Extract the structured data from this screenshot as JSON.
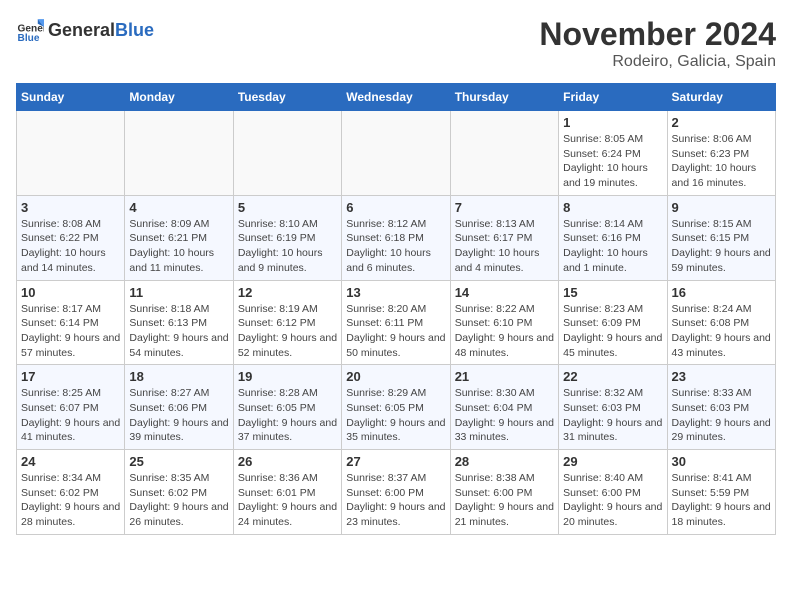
{
  "header": {
    "logo_general": "General",
    "logo_blue": "Blue",
    "month_title": "November 2024",
    "location": "Rodeiro, Galicia, Spain"
  },
  "weekdays": [
    "Sunday",
    "Monday",
    "Tuesday",
    "Wednesday",
    "Thursday",
    "Friday",
    "Saturday"
  ],
  "weeks": [
    [
      {
        "day": "",
        "info": ""
      },
      {
        "day": "",
        "info": ""
      },
      {
        "day": "",
        "info": ""
      },
      {
        "day": "",
        "info": ""
      },
      {
        "day": "",
        "info": ""
      },
      {
        "day": "1",
        "info": "Sunrise: 8:05 AM\nSunset: 6:24 PM\nDaylight: 10 hours and 19 minutes."
      },
      {
        "day": "2",
        "info": "Sunrise: 8:06 AM\nSunset: 6:23 PM\nDaylight: 10 hours and 16 minutes."
      }
    ],
    [
      {
        "day": "3",
        "info": "Sunrise: 8:08 AM\nSunset: 6:22 PM\nDaylight: 10 hours and 14 minutes."
      },
      {
        "day": "4",
        "info": "Sunrise: 8:09 AM\nSunset: 6:21 PM\nDaylight: 10 hours and 11 minutes."
      },
      {
        "day": "5",
        "info": "Sunrise: 8:10 AM\nSunset: 6:19 PM\nDaylight: 10 hours and 9 minutes."
      },
      {
        "day": "6",
        "info": "Sunrise: 8:12 AM\nSunset: 6:18 PM\nDaylight: 10 hours and 6 minutes."
      },
      {
        "day": "7",
        "info": "Sunrise: 8:13 AM\nSunset: 6:17 PM\nDaylight: 10 hours and 4 minutes."
      },
      {
        "day": "8",
        "info": "Sunrise: 8:14 AM\nSunset: 6:16 PM\nDaylight: 10 hours and 1 minute."
      },
      {
        "day": "9",
        "info": "Sunrise: 8:15 AM\nSunset: 6:15 PM\nDaylight: 9 hours and 59 minutes."
      }
    ],
    [
      {
        "day": "10",
        "info": "Sunrise: 8:17 AM\nSunset: 6:14 PM\nDaylight: 9 hours and 57 minutes."
      },
      {
        "day": "11",
        "info": "Sunrise: 8:18 AM\nSunset: 6:13 PM\nDaylight: 9 hours and 54 minutes."
      },
      {
        "day": "12",
        "info": "Sunrise: 8:19 AM\nSunset: 6:12 PM\nDaylight: 9 hours and 52 minutes."
      },
      {
        "day": "13",
        "info": "Sunrise: 8:20 AM\nSunset: 6:11 PM\nDaylight: 9 hours and 50 minutes."
      },
      {
        "day": "14",
        "info": "Sunrise: 8:22 AM\nSunset: 6:10 PM\nDaylight: 9 hours and 48 minutes."
      },
      {
        "day": "15",
        "info": "Sunrise: 8:23 AM\nSunset: 6:09 PM\nDaylight: 9 hours and 45 minutes."
      },
      {
        "day": "16",
        "info": "Sunrise: 8:24 AM\nSunset: 6:08 PM\nDaylight: 9 hours and 43 minutes."
      }
    ],
    [
      {
        "day": "17",
        "info": "Sunrise: 8:25 AM\nSunset: 6:07 PM\nDaylight: 9 hours and 41 minutes."
      },
      {
        "day": "18",
        "info": "Sunrise: 8:27 AM\nSunset: 6:06 PM\nDaylight: 9 hours and 39 minutes."
      },
      {
        "day": "19",
        "info": "Sunrise: 8:28 AM\nSunset: 6:05 PM\nDaylight: 9 hours and 37 minutes."
      },
      {
        "day": "20",
        "info": "Sunrise: 8:29 AM\nSunset: 6:05 PM\nDaylight: 9 hours and 35 minutes."
      },
      {
        "day": "21",
        "info": "Sunrise: 8:30 AM\nSunset: 6:04 PM\nDaylight: 9 hours and 33 minutes."
      },
      {
        "day": "22",
        "info": "Sunrise: 8:32 AM\nSunset: 6:03 PM\nDaylight: 9 hours and 31 minutes."
      },
      {
        "day": "23",
        "info": "Sunrise: 8:33 AM\nSunset: 6:03 PM\nDaylight: 9 hours and 29 minutes."
      }
    ],
    [
      {
        "day": "24",
        "info": "Sunrise: 8:34 AM\nSunset: 6:02 PM\nDaylight: 9 hours and 28 minutes."
      },
      {
        "day": "25",
        "info": "Sunrise: 8:35 AM\nSunset: 6:02 PM\nDaylight: 9 hours and 26 minutes."
      },
      {
        "day": "26",
        "info": "Sunrise: 8:36 AM\nSunset: 6:01 PM\nDaylight: 9 hours and 24 minutes."
      },
      {
        "day": "27",
        "info": "Sunrise: 8:37 AM\nSunset: 6:00 PM\nDaylight: 9 hours and 23 minutes."
      },
      {
        "day": "28",
        "info": "Sunrise: 8:38 AM\nSunset: 6:00 PM\nDaylight: 9 hours and 21 minutes."
      },
      {
        "day": "29",
        "info": "Sunrise: 8:40 AM\nSunset: 6:00 PM\nDaylight: 9 hours and 20 minutes."
      },
      {
        "day": "30",
        "info": "Sunrise: 8:41 AM\nSunset: 5:59 PM\nDaylight: 9 hours and 18 minutes."
      }
    ]
  ]
}
